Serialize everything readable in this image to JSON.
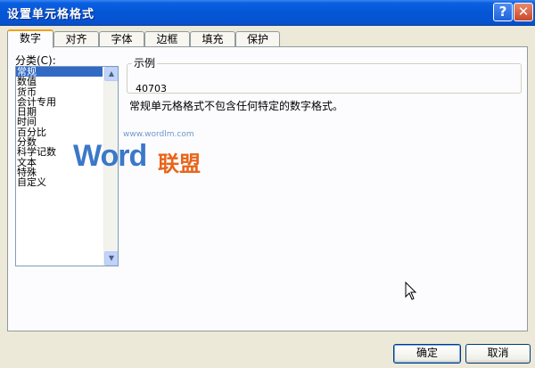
{
  "window": {
    "title": "设置单元格格式",
    "help_glyph": "?",
    "close_glyph": "✕"
  },
  "tabs": [
    {
      "label": "数字",
      "active": true
    },
    {
      "label": "对齐",
      "active": false
    },
    {
      "label": "字体",
      "active": false
    },
    {
      "label": "边框",
      "active": false
    },
    {
      "label": "填充",
      "active": false
    },
    {
      "label": "保护",
      "active": false
    }
  ],
  "category": {
    "label": "分类(C):",
    "items": [
      "常规",
      "数值",
      "货币",
      "会计专用",
      "日期",
      "时间",
      "百分比",
      "分数",
      "科学记数",
      "文本",
      "特殊",
      "自定义"
    ],
    "selected_index": 0
  },
  "sample": {
    "legend": "示例",
    "value": "40703"
  },
  "description": "常规单元格格式不包含任何特定的数字格式。",
  "watermark": {
    "url": "www.wordlm.com",
    "word": "Word",
    "cn": "联盟"
  },
  "buttons": {
    "ok": "确定",
    "cancel": "取消"
  },
  "colors": {
    "title_bar": "#0556D6",
    "selected_item": "#316AC5",
    "active_tab_accent": "#F5A21B"
  }
}
